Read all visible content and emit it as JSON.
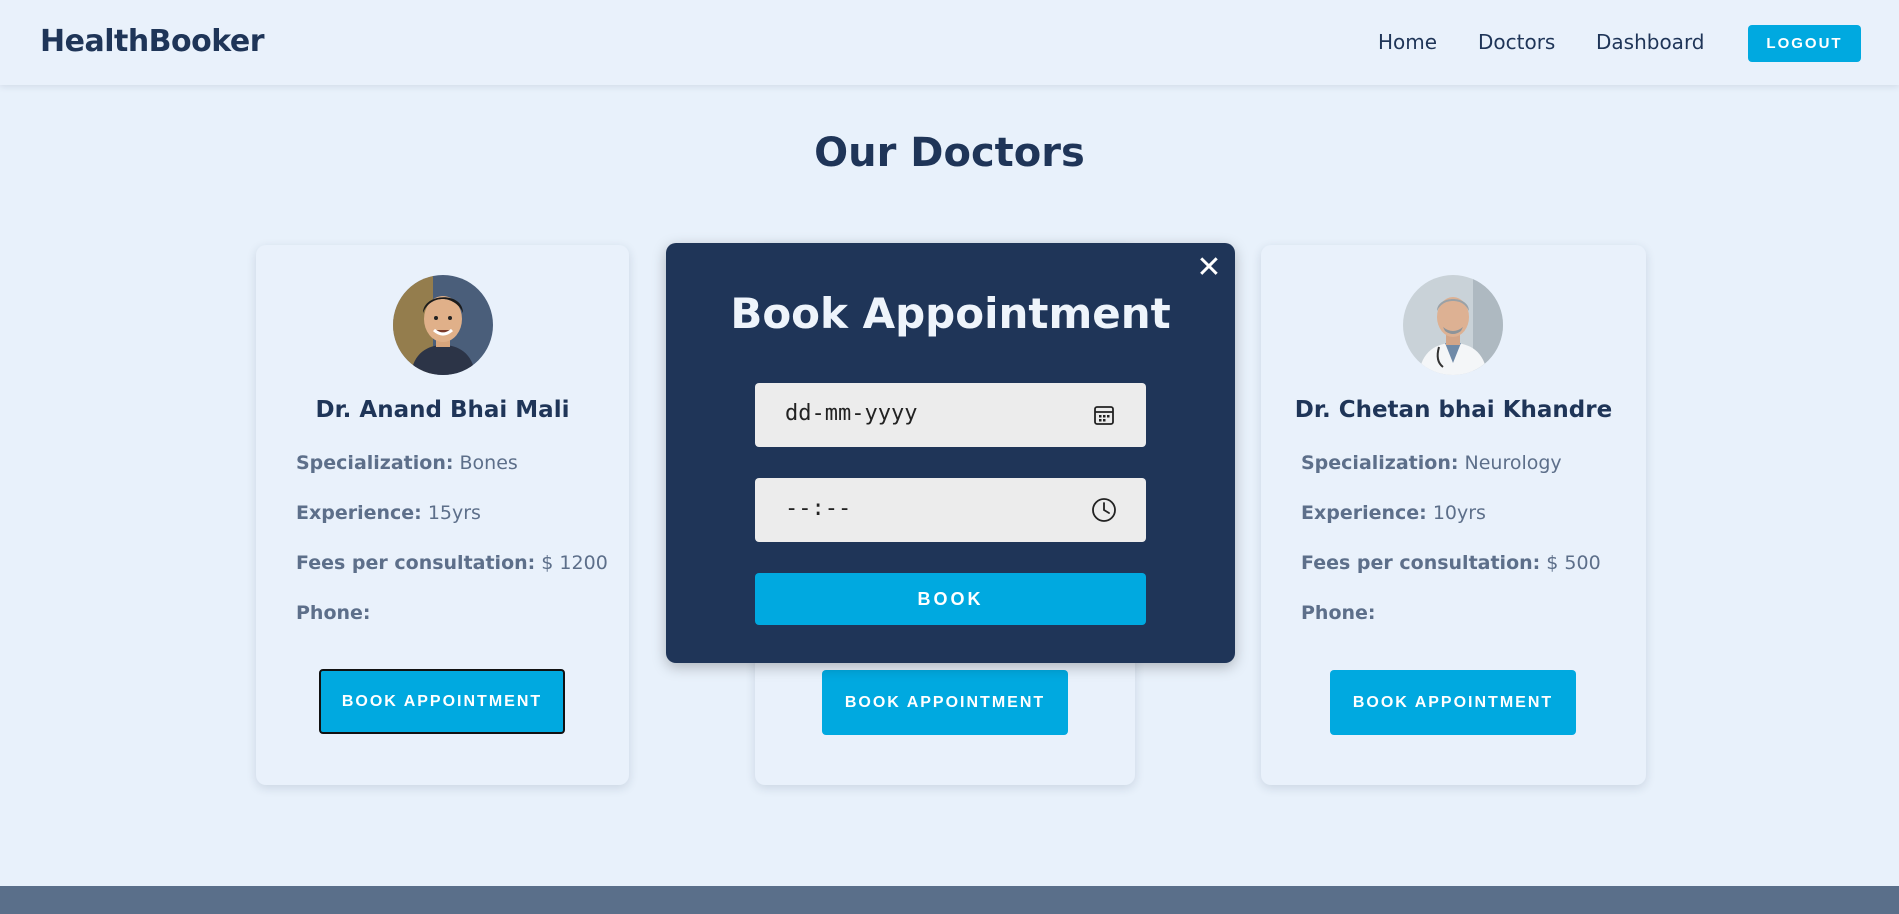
{
  "navbar": {
    "brand": "HealthBooker",
    "links": [
      "Home",
      "Doctors",
      "Dashboard"
    ],
    "logout_label": "LOGOUT"
  },
  "page": {
    "title": "Our Doctors"
  },
  "labels": {
    "specialization": "Specialization:",
    "experience": "Experience:",
    "fees": "Fees per consultation:",
    "phone": "Phone:",
    "book_appointment": "BOOK APPOINTMENT"
  },
  "doctors": [
    {
      "name": "Dr. Anand Bhai Mali",
      "specialization": "Bones",
      "experience": "15yrs",
      "fees": "$ 1200",
      "phone": ""
    },
    {
      "name": "Dr. Chetan bhai Khandre",
      "specialization": "Neurology",
      "experience": "10yrs",
      "fees": "$ 500",
      "phone": ""
    }
  ],
  "modal": {
    "title": "Book Appointment",
    "date_placeholder": "dd-mm-yyyy",
    "time_placeholder": "--:--",
    "book_label": "BOOK",
    "close_symbol": "✕"
  },
  "icons": {
    "calendar": "calendar-icon",
    "clock": "clock-icon",
    "close": "close-icon"
  },
  "colors": {
    "accent": "#00a9e0",
    "primary_dark": "#1f3558",
    "background": "#e8f1fb",
    "footer": "#5a6f8a"
  }
}
